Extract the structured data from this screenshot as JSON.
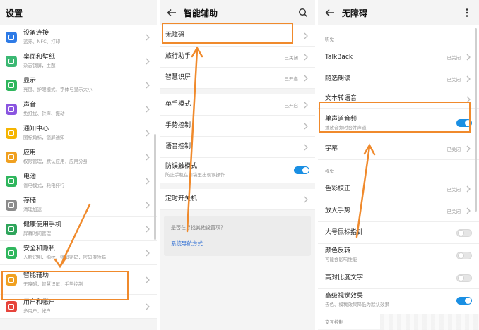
{
  "panel1": {
    "title": "设置",
    "items": [
      {
        "title": "设备连接",
        "sub": "蓝牙、NFC、打印",
        "icon": "device-connect-icon",
        "color": "#2e7be6"
      },
      {
        "title": "桌面和壁纸",
        "sub": "杂志锁屏，主题",
        "icon": "wallpaper-icon",
        "color": "#3bb873"
      },
      {
        "title": "显示",
        "sub": "亮度、护眼模式，字体与显示大小",
        "icon": "display-icon",
        "color": "#2fb65d"
      },
      {
        "title": "声音",
        "sub": "免打扰、铃声、振动",
        "icon": "sound-icon",
        "color": "#8a55e0"
      },
      {
        "title": "通知中心",
        "sub": "图标角标，锁屏通知",
        "icon": "notification-icon",
        "color": "#f5b400"
      },
      {
        "title": "应用",
        "sub": "权限管理，默认应用，应用分身",
        "icon": "apps-icon",
        "color": "#f0a020"
      },
      {
        "title": "电池",
        "sub": "省电模式，耗电排行",
        "icon": "battery-icon",
        "color": "#2fb65d"
      },
      {
        "title": "存储",
        "sub": "清理加速",
        "icon": "storage-icon",
        "color": "#8c8c8c"
      },
      {
        "title": "健康使用手机",
        "sub": "屏幕时间管理",
        "icon": "hourglass-icon",
        "color": "#2fa55b"
      },
      {
        "title": "安全和隐私",
        "sub": "人脸识别，指纹，锁屏密码，密码保险箱",
        "icon": "security-icon",
        "color": "#2fb65d"
      },
      {
        "title": "智能辅助",
        "sub": "无障碍，智慧识屏，手势控制",
        "icon": "hand-icon",
        "color": "#f0a020"
      },
      {
        "title": "用户和帐户",
        "sub": "多用户，帐户",
        "icon": "user-icon",
        "color": "#e6443c"
      }
    ]
  },
  "panel2": {
    "title": "智能辅助",
    "items": [
      {
        "title": "无障碍",
        "status": ""
      },
      {
        "title": "旅行助手",
        "status": "已关闭"
      },
      {
        "title": "智慧识屏",
        "status": "已开启"
      },
      {
        "title": "单手模式",
        "status": "已开启"
      },
      {
        "title": "手势控制",
        "status": ""
      },
      {
        "title": "语音控制",
        "status": ""
      }
    ],
    "anti_touch": {
      "title": "防误触模式",
      "sub": "防止手机在口袋里出现误操作",
      "on": true
    },
    "timer": {
      "title": "定时开关机"
    },
    "find_question": "是否在寻找其他设置项？",
    "find_link": "系统导航方式"
  },
  "panel3": {
    "title": "无障碍",
    "sections": {
      "hearing": "听觉",
      "vision": "视觉",
      "interaction": "交互控制"
    },
    "hearing_items": [
      {
        "title": "TalkBack",
        "status": "已关闭"
      },
      {
        "title": "随选朗读",
        "status": "已关闭"
      },
      {
        "title": "文本转语音",
        "status": ""
      }
    ],
    "mono": {
      "title": "单声道音频",
      "sub": "播放音频时合并声道",
      "on": true
    },
    "subtitle": {
      "title": "字幕",
      "status": "已关闭"
    },
    "vision_items": [
      {
        "title": "色彩校正",
        "status": "已关闭"
      },
      {
        "title": "放大手势",
        "status": "已关闭"
      }
    ],
    "toggles": [
      {
        "title": "大号鼠标指针",
        "sub": "",
        "on": false
      },
      {
        "title": "颜色反转",
        "sub": "可能会影响性能",
        "on": false
      },
      {
        "title": "高对比度文字",
        "sub": "",
        "on": false
      },
      {
        "title": "高级视觉效果",
        "sub": "去色、模糊效果降低为默认效果",
        "on": true
      }
    ]
  },
  "colors": {
    "accent": "#f08a2c",
    "toggle_on": "#1a8fe3",
    "link": "#2a6bd3"
  }
}
